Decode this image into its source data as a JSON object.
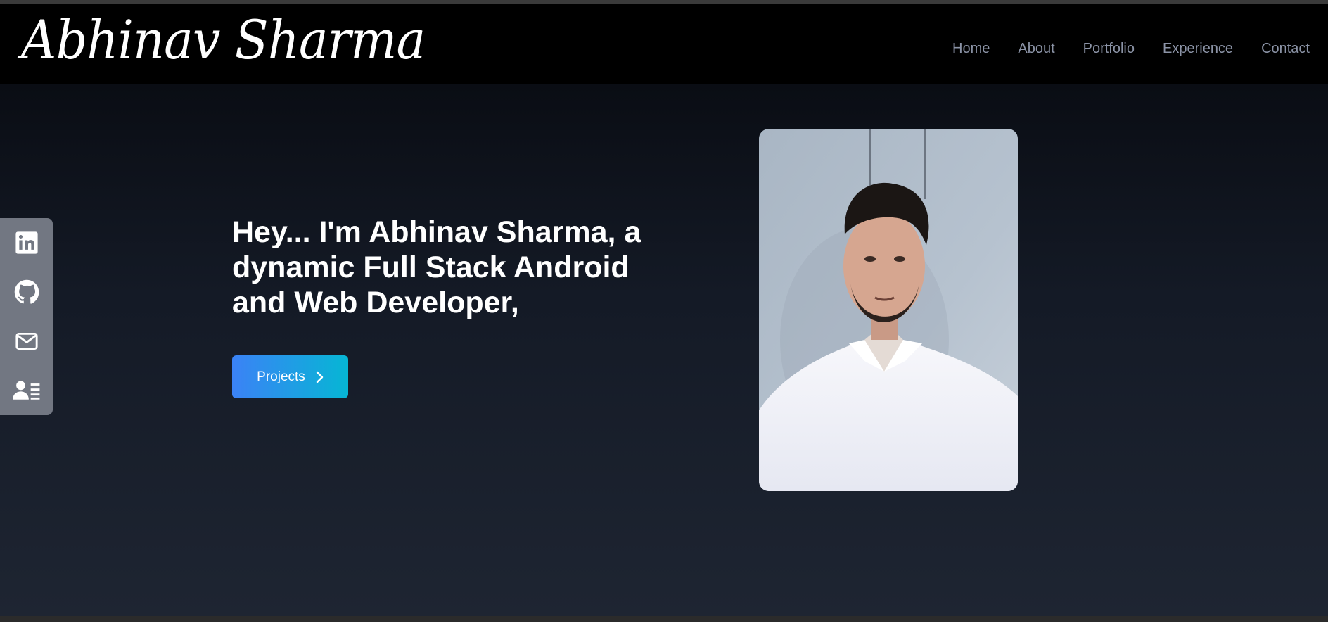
{
  "header": {
    "logo_text": "Abhinav Sharma",
    "nav": [
      "Home",
      "About",
      "Portfolio",
      "Experience",
      "Contact"
    ]
  },
  "social": [
    {
      "icon": "linkedin-icon"
    },
    {
      "icon": "github-icon"
    },
    {
      "icon": "mail-icon"
    },
    {
      "icon": "resume-icon"
    }
  ],
  "hero": {
    "headline": "Hey... I'm Abhinav Sharma, a dynamic Full Stack Android and Web Developer,",
    "cta_label": "Projects"
  },
  "colors": {
    "nav_bg": "#000000",
    "nav_link": "#8b93a6",
    "cta_gradient_start": "#3b82f6",
    "cta_gradient_end": "#06b6d4",
    "social_bar_bg": "#727782"
  }
}
